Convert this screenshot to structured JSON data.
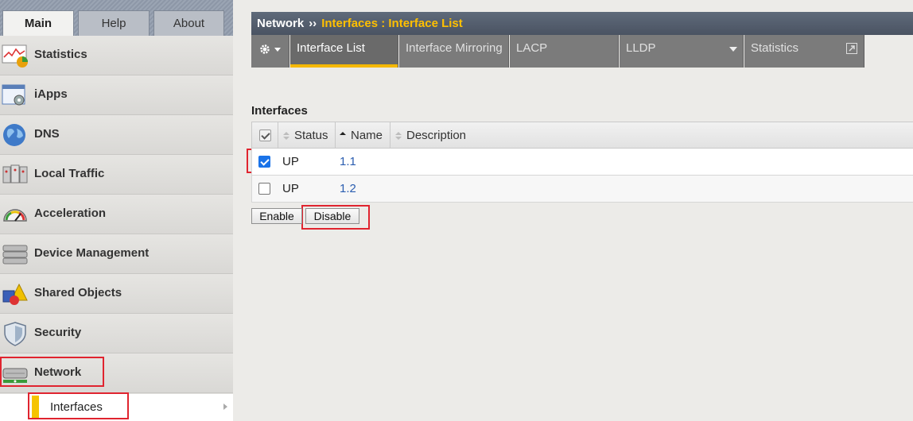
{
  "left_tabs": [
    {
      "label": "Main",
      "active": true
    },
    {
      "label": "Help",
      "active": false
    },
    {
      "label": "About",
      "active": false
    }
  ],
  "sidebar": {
    "items": [
      {
        "label": "Statistics",
        "icon": "statistics-icon"
      },
      {
        "label": "iApps",
        "icon": "iapps-icon"
      },
      {
        "label": "DNS",
        "icon": "globe-icon"
      },
      {
        "label": "Local Traffic",
        "icon": "local-traffic-icon"
      },
      {
        "label": "Acceleration",
        "icon": "speedometer-icon"
      },
      {
        "label": "Device Management",
        "icon": "server-icon"
      },
      {
        "label": "Shared Objects",
        "icon": "shapes-icon"
      },
      {
        "label": "Security",
        "icon": "shield-icon"
      },
      {
        "label": "Network",
        "icon": "network-device-icon"
      }
    ],
    "sub_item": {
      "label": "Interfaces"
    }
  },
  "header": {
    "section": "Network",
    "separator": "››",
    "current": "Interfaces : Interface List"
  },
  "subtabs": [
    {
      "label": "Interface List",
      "active": true
    },
    {
      "label": "Interface Mirroring",
      "active": false
    },
    {
      "label": "LACP",
      "active": false
    },
    {
      "label": "LLDP",
      "active": false,
      "has_dropdown": true
    },
    {
      "label": "Statistics",
      "active": false,
      "has_external": true
    }
  ],
  "content": {
    "title": "Interfaces",
    "columns": [
      "Status",
      "Name",
      "Description"
    ],
    "rows": [
      {
        "checked": true,
        "status": "UP",
        "name": "1.1",
        "description": ""
      },
      {
        "checked": false,
        "status": "UP",
        "name": "1.2",
        "description": ""
      }
    ],
    "buttons": {
      "enable": "Enable",
      "disable": "Disable"
    }
  },
  "colors": {
    "accent": "#f5c400",
    "header_current": "#ffc000",
    "highlight_box": "#e0242f",
    "link": "#2a5db0"
  }
}
